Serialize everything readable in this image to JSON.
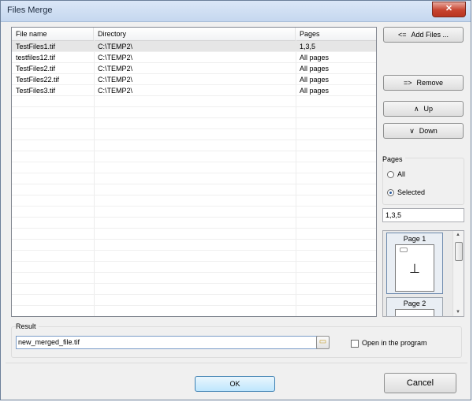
{
  "window": {
    "title": "Files Merge",
    "close_glyph": "✕"
  },
  "file_list": {
    "columns": [
      "File name",
      "Directory",
      "Pages"
    ],
    "rows": [
      [
        "TestFiles1.tif",
        "C:\\TEMP2\\",
        "1,3,5"
      ],
      [
        "testfiles12.tif",
        "C:\\TEMP2\\",
        "All pages"
      ],
      [
        "TestFiles2.tif",
        "C:\\TEMP2\\",
        "All pages"
      ],
      [
        "TestFiles22.tif",
        "C:\\TEMP2\\",
        "All pages"
      ],
      [
        "TestFiles3.tif",
        "C:\\TEMP2\\",
        "All pages"
      ]
    ]
  },
  "buttons": {
    "add_files": "Add Files ...",
    "add_files_icon": "<=",
    "remove": "Remove",
    "remove_icon": "=>",
    "up": "Up",
    "up_icon": "∧",
    "down": "Down",
    "down_icon": "∨",
    "ok": "OK",
    "cancel": "Cancel"
  },
  "pages": {
    "label": "Pages",
    "options": [
      "All",
      "Selected"
    ],
    "selected": "Selected",
    "value": "1,3,5"
  },
  "preview": {
    "pages": [
      "Page 1",
      "Page 2"
    ],
    "page1_glyph": "⊥"
  },
  "result": {
    "label": "Result",
    "filename": "new_merged_file.tif",
    "open_in_program": "Open in the program",
    "open_in_program_checked": false
  }
}
